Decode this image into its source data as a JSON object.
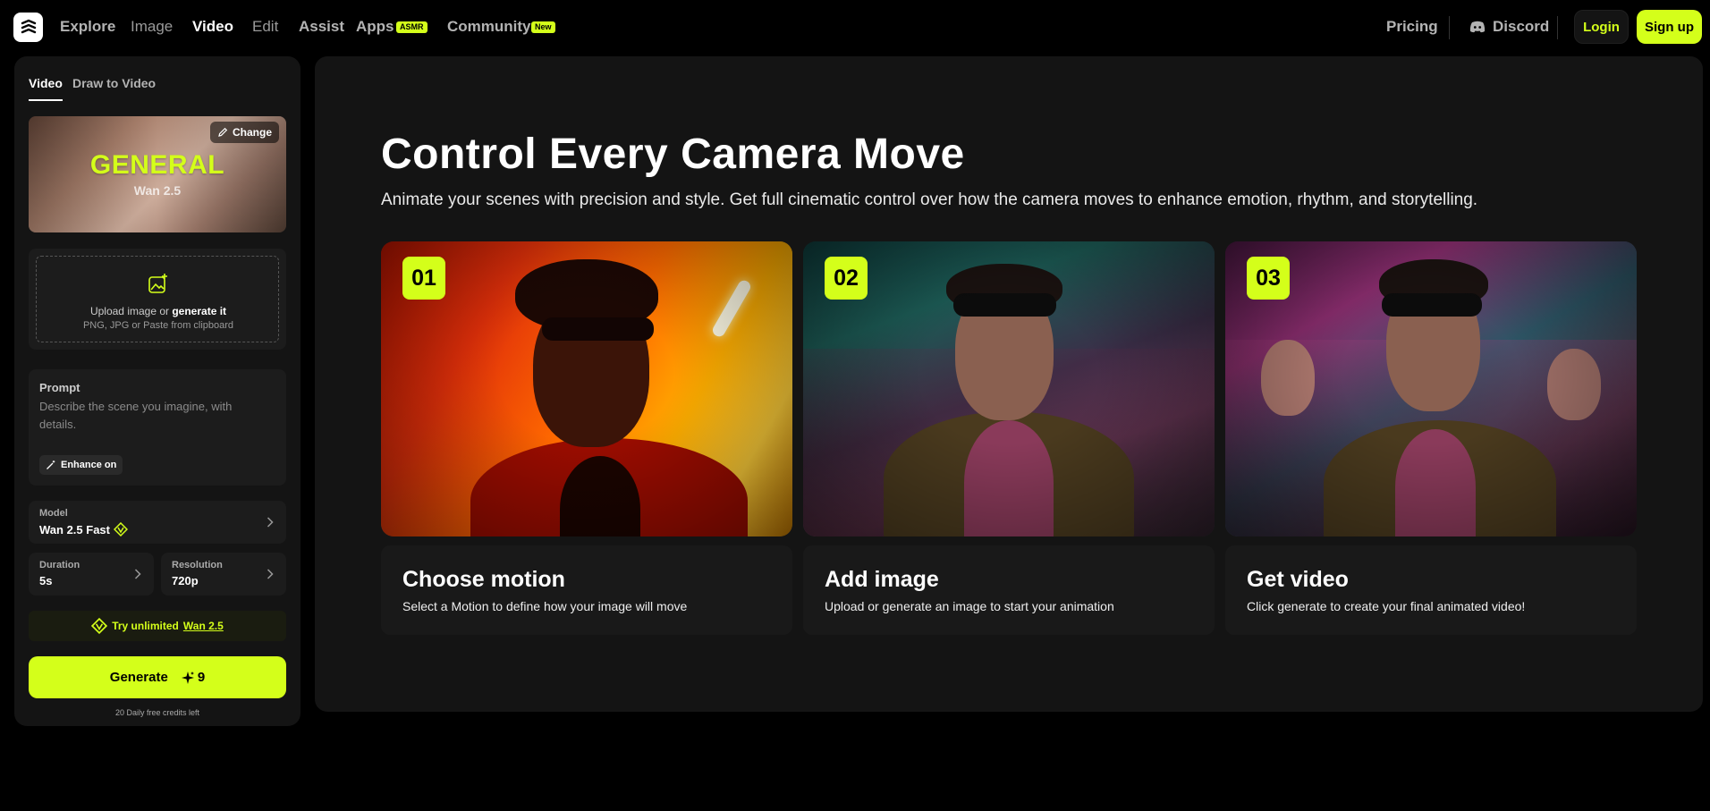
{
  "nav": {
    "items": [
      "Explore",
      "Image",
      "Video",
      "Edit",
      "Assist",
      "Apps",
      "Community"
    ],
    "apps_badge": "ASMR",
    "community_badge": "New",
    "pricing": "Pricing",
    "discord": "Discord",
    "login": "Login",
    "signup": "Sign up"
  },
  "sidebar": {
    "tabs": [
      "Video",
      "Draw to Video"
    ],
    "hero": {
      "title": "GENERAL",
      "subtitle": "Wan 2.5",
      "change": "Change"
    },
    "upload": {
      "line1_prefix": "Upload image or ",
      "line1_link": "generate it",
      "line2": "PNG, JPG or Paste from clipboard"
    },
    "prompt": {
      "label": "Prompt",
      "placeholder": "Describe the scene you imagine, with details.",
      "enhance": "Enhance on"
    },
    "model": {
      "label": "Model",
      "value": "Wan 2.5 Fast"
    },
    "duration": {
      "label": "Duration",
      "value": "5s"
    },
    "resolution": {
      "label": "Resolution",
      "value": "720p"
    },
    "try": {
      "prefix": "Try unlimited",
      "link": "Wan 2.5"
    },
    "generate": {
      "label": "Generate",
      "credits": "9"
    },
    "daily": "20 Daily free credits left"
  },
  "main": {
    "title": "Control Every Camera Move",
    "subtitle": "Animate your scenes with precision and style. Get full cinematic control over how the camera moves to enhance emotion, rhythm, and storytelling.",
    "steps": [
      {
        "num": "01",
        "title": "Choose motion",
        "desc": "Select a Motion to define how your image will move"
      },
      {
        "num": "02",
        "title": "Add image",
        "desc": "Upload or generate an image to start your animation"
      },
      {
        "num": "03",
        "title": "Get video",
        "desc": "Click generate to create your final animated video!"
      }
    ]
  },
  "colors": {
    "accent": "#d4ff1a",
    "panel": "#141414",
    "card": "#1c1c1c"
  }
}
